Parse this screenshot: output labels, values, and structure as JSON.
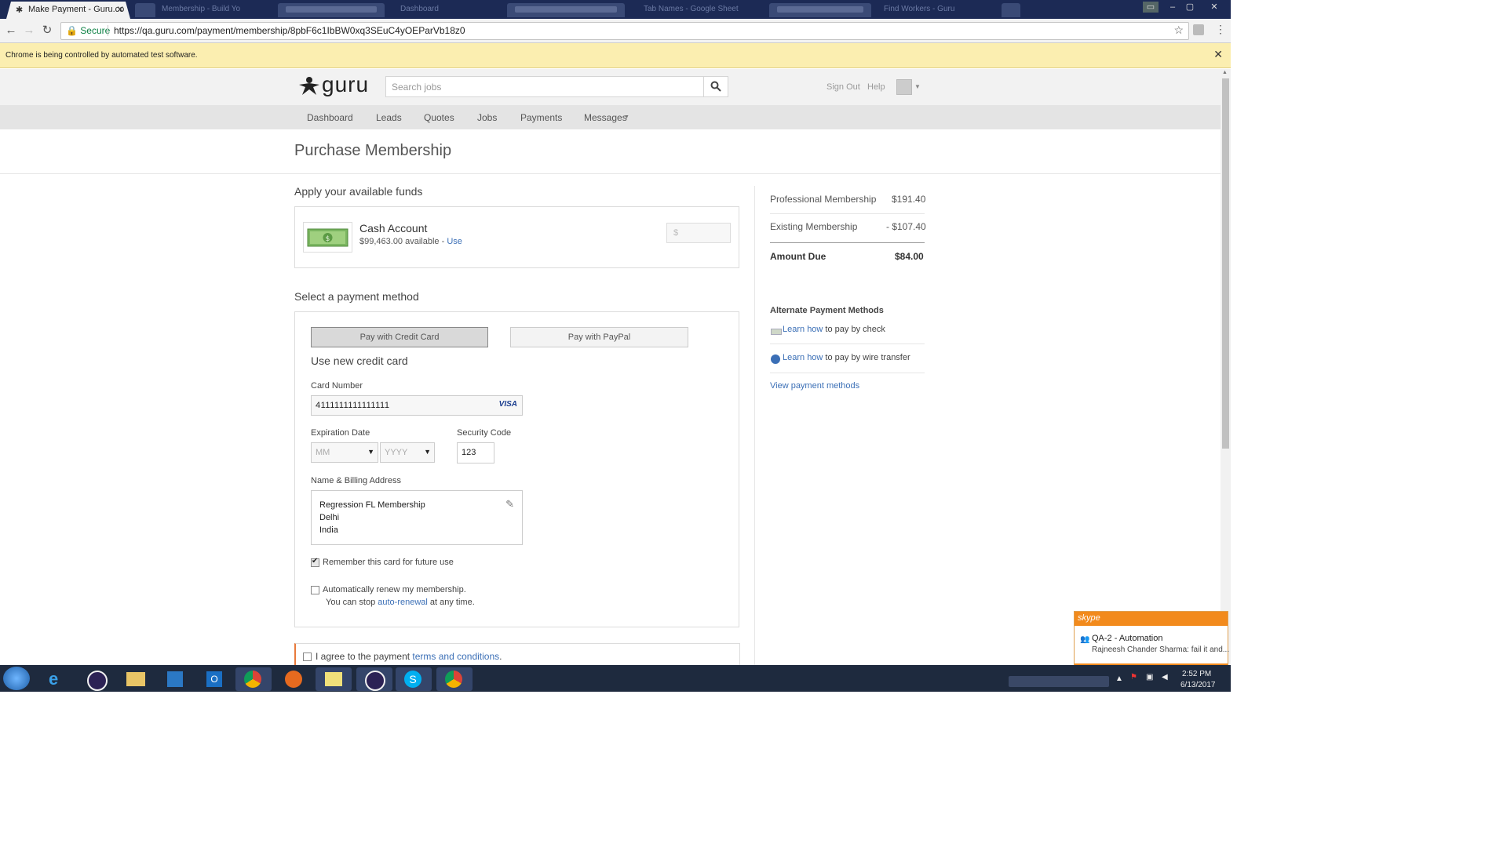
{
  "browser": {
    "tab_title": "Make Payment - Guru.co",
    "other_tabs": [
      "Membership - Build Yo",
      "",
      "Dashboard",
      "",
      "Tab Names - Google Sheet",
      "",
      "Find Workers - Guru"
    ],
    "secure_label": "Secure",
    "url": "https://qa.guru.com/payment/membership/8pbF6c1IbBW0xq3SEuC4yOEParVb18z0",
    "infobar_text": "Chrome is being controlled by automated test software."
  },
  "site": {
    "logo": "guru",
    "search_placeholder": "Search jobs",
    "sign_out": "Sign Out",
    "help": "Help",
    "nav": [
      "Dashboard",
      "Leads",
      "Quotes",
      "Jobs",
      "Payments",
      "Messages"
    ]
  },
  "page": {
    "title": "Purchase Membership",
    "funds_heading": "Apply your available funds",
    "cash_account_title": "Cash Account",
    "cash_available": "$99,463.00 available - ",
    "cash_use_link": "Use",
    "cash_amount_placeholder": "$",
    "payment_heading": "Select a payment method",
    "pay_credit_card": "Pay with Credit Card",
    "pay_paypal": "Pay with PayPal",
    "new_card_heading": "Use new credit card",
    "card_number_label": "Card Number",
    "card_number_value": "4111111111111111",
    "card_brand": "VISA",
    "expiration_label": "Expiration Date",
    "exp_month_placeholder": "MM",
    "exp_year_placeholder": "YYYY",
    "security_label": "Security Code",
    "security_value": "123",
    "billing_label": "Name & Billing Address",
    "billing_lines": [
      "Regression FL Membership",
      "Delhi",
      "India"
    ],
    "remember_card": "Remember this card for future use",
    "auto_renew_line1": "Automatically renew my membership.",
    "auto_renew_line2_pre": "You can stop ",
    "auto_renew_link": "auto-renewal",
    "auto_renew_line2_post": " at any time.",
    "agree_pre": "I agree to the payment ",
    "agree_link": "terms and conditions",
    "agree_post": "."
  },
  "summary": {
    "professional_label": "Professional Membership",
    "professional_value": "$191.40",
    "existing_label": "Existing Membership",
    "existing_value": "- $107.40",
    "due_label": "Amount Due",
    "due_value": "$84.00",
    "alt_heading": "Alternate Payment Methods",
    "check_link": "Learn how",
    "check_text": " to pay by check",
    "wire_link": "Learn how",
    "wire_text": " to pay by wire transfer",
    "view_methods": "View payment methods"
  },
  "skype": {
    "brand": "skype",
    "chat_title": "QA-2 - Automation",
    "preview": "Rajneesh Chander Sharma: fail it and..."
  },
  "taskbar": {
    "time": "2:52 PM",
    "date": "6/13/2017"
  },
  "colors": {
    "link": "#3b6fb6",
    "skype_orange": "#f28a1c",
    "infobar": "#fbeeb0",
    "secure_green": "#0b8043"
  }
}
